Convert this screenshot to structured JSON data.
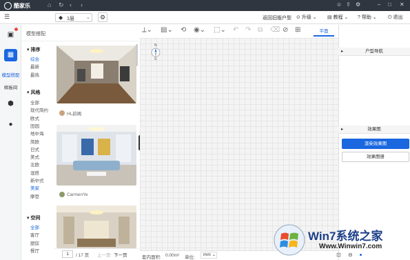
{
  "app": {
    "brand": "酷家乐",
    "floor": "1层"
  },
  "header": {
    "return_old": "返回旧版户型",
    "upgrade": "升级",
    "tutorial": "教程",
    "help": "帮助",
    "exit": "退出"
  },
  "nav": {
    "items": [
      {
        "label": "模型搭配",
        "active": true
      },
      {
        "label": "样板间",
        "active": false
      }
    ]
  },
  "panel": {
    "title": "模型搭配"
  },
  "filters": {
    "sort": {
      "title": "排序",
      "items": [
        "综合",
        "最新",
        "最热"
      ],
      "active": 0
    },
    "style": {
      "title": "风格",
      "items": [
        "全部",
        "现代简约",
        "欧式",
        "田园",
        "地中海",
        "简欧",
        "日式",
        "美式",
        "北欧",
        "混搭",
        "新中式",
        "美家",
        "摩登"
      ],
      "active": 11
    },
    "space": {
      "title": "空间",
      "items": [
        "全部",
        "客厅",
        "厨房",
        "餐厅"
      ],
      "active": 0
    }
  },
  "cards": [
    {
      "author": "HL韵阁"
    },
    {
      "author": "CarmenYe"
    },
    {
      "author": ""
    }
  ],
  "pager": {
    "page": "1",
    "total": "/ 17 页",
    "prev": "上一页",
    "next": "下一页"
  },
  "views": {
    "plan": "平面",
    "top": "顶面",
    "three_d": "3D"
  },
  "compass": {
    "north": "N",
    "south": "S"
  },
  "status": {
    "area_label": "套内面积:",
    "area_value": "0.00m²",
    "unit_label": "单位:",
    "unit_value": "mm"
  },
  "right": {
    "nav_title": "户型导航",
    "effect_title": "效果图",
    "render_btn": "渲染效果图",
    "gallery_btn": "效果图册"
  },
  "watermark": {
    "line1": "Win7系统之家",
    "line2": "Www.Winwin7.com"
  },
  "colors": {
    "accent": "#1a67e0",
    "titlebar": "#2f3640"
  }
}
